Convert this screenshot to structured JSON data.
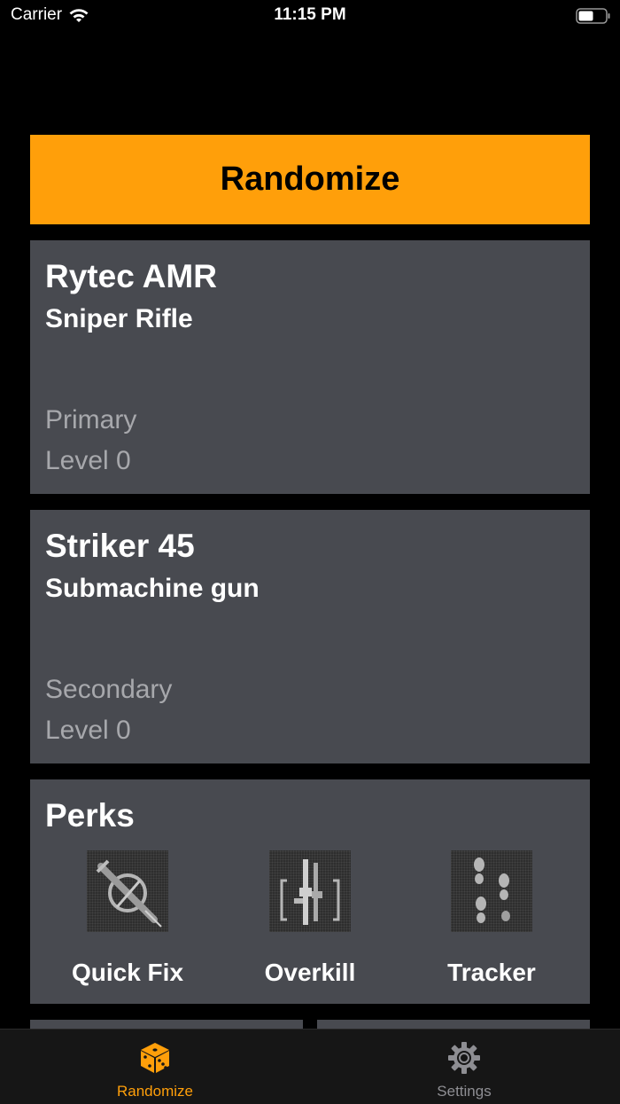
{
  "status_bar": {
    "carrier": "Carrier",
    "time": "11:15 PM"
  },
  "randomize_button": {
    "label": "Randomize",
    "color": "#FF9F0A"
  },
  "primary_card": {
    "name": "Rytec AMR",
    "type": "Sniper Rifle",
    "slot": "Primary",
    "level": "Level 0"
  },
  "secondary_card": {
    "name": "Striker 45",
    "type": "Submachine gun",
    "slot": "Secondary",
    "level": "Level 0"
  },
  "perks": {
    "title": "Perks",
    "items": [
      {
        "label": "Quick Fix",
        "icon": "syringe-icon"
      },
      {
        "label": "Overkill",
        "icon": "rifles-icon"
      },
      {
        "label": "Tracker",
        "icon": "footprints-icon"
      }
    ]
  },
  "tab_bar": {
    "tabs": [
      {
        "label": "Randomize",
        "icon": "dice-icon",
        "active": true
      },
      {
        "label": "Settings",
        "icon": "gear-icon",
        "active": false
      }
    ],
    "active_color": "#FF9F0A",
    "inactive_color": "#8E8E93"
  },
  "colors": {
    "background": "#000000",
    "card": "#484A50",
    "secondary_text": "#A7A8AC"
  }
}
